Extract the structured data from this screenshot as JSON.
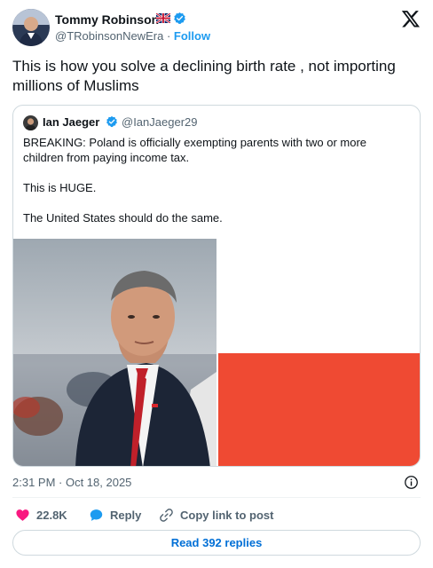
{
  "author": {
    "name": "Tommy Robinson",
    "handle": "@TRobinsonNewEra",
    "separator": "·",
    "follow_label": "Follow",
    "flag_icon": "uk-flag-icon",
    "verified_icon": "verified-badge-icon"
  },
  "platform_logo": "x-logo-icon",
  "tweet_text": "This is how you solve a declining birth rate , not importing millions of Muslims",
  "quoted": {
    "name": "Ian Jaeger",
    "handle": "@IanJaeger29",
    "paragraphs": [
      "BREAKING: Poland is officially exempting parents with two or more children from paying income tax.",
      "This is HUGE.",
      "The United States should do the same."
    ],
    "images": [
      "portrait-photo",
      "poland-flag"
    ]
  },
  "timestamp": "2:31 PM · Oct 18, 2025",
  "actions": {
    "likes": "22.8K",
    "reply_label": "Reply",
    "copy_label": "Copy link to post"
  },
  "read_replies_label": "Read 392 replies",
  "colors": {
    "accent": "#1d9bf0",
    "link": "#006fd6",
    "like": "#f91880",
    "muted": "#536471",
    "flag_red": "#ef4a33"
  }
}
